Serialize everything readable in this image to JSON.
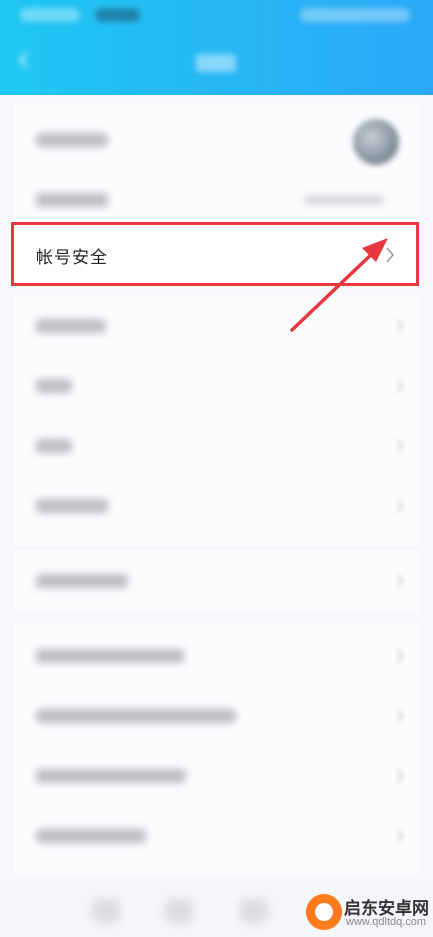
{
  "header": {
    "title": "",
    "background_start": "#1fc8f3",
    "background_end": "#2aa8f6"
  },
  "highlighted_row": {
    "label": "帐号安全",
    "icon": "chevron-right-icon",
    "outline_color": "#e8373f"
  },
  "annotation": {
    "icon": "red-arrow-icon",
    "color": "#e8373f"
  },
  "watermark": {
    "title": "启东安卓网",
    "url": "www.qdltdq.com",
    "accent": "#ff7a1a"
  }
}
